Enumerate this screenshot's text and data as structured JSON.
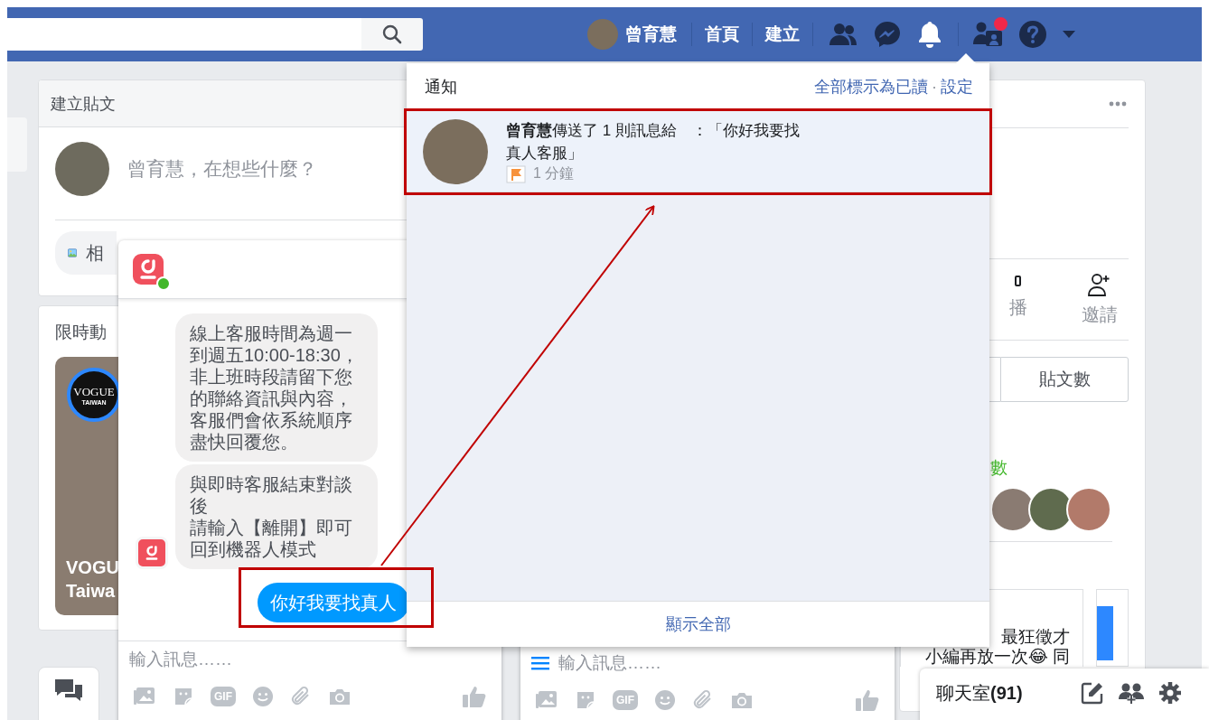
{
  "top_bar": {
    "profile_name": "曾育慧",
    "nav_links": [
      "首頁",
      "建立"
    ],
    "icons": [
      {
        "kind": "friends",
        "selected": false,
        "badge": false
      },
      {
        "kind": "messenger",
        "selected": false,
        "badge": false
      },
      {
        "kind": "notifications",
        "selected": true,
        "badge": false
      },
      {
        "kind": "friend_requests",
        "selected": false,
        "badge": true
      },
      {
        "kind": "help",
        "selected": false,
        "badge": false
      },
      {
        "kind": "account_menu",
        "selected": false,
        "badge": false
      }
    ]
  },
  "create_post": {
    "title": "建立貼文",
    "placeholder": "曾育慧，在想些什麼？",
    "photo_button": "相"
  },
  "stories": {
    "title": "限時動",
    "story": {
      "logo": [
        "VOGUE",
        "TAIWAN"
      ],
      "caption": [
        "VOGU",
        "Taiwa"
      ]
    }
  },
  "chat": {
    "online": true,
    "messages": [
      {
        "kind": "bot",
        "avatar": false,
        "paragraphs": [
          "線上客服時間為週一到週五10:00-18:30，非上班時段請留下您的聯絡資訊與內容，客服們會依系統順序盡快回覆您。"
        ]
      },
      {
        "kind": "bot",
        "avatar": true,
        "paragraphs": [
          "與即時客服結束對談後",
          "請輸入【離開】即可回到機器人模式"
        ]
      },
      {
        "kind": "user",
        "paragraphs": [
          "你好我要找真人"
        ]
      }
    ],
    "input_placeholder": "輸入訊息……",
    "tools": [
      {
        "kind": "photo"
      },
      {
        "kind": "sticker"
      },
      {
        "kind": "gif",
        "label": "GIF"
      },
      {
        "kind": "emoji"
      },
      {
        "kind": "attach"
      },
      {
        "kind": "camera"
      }
    ]
  },
  "chat_2": {
    "input_placeholder": "輸入訊息……",
    "tools": [
      {
        "kind": "photo"
      },
      {
        "kind": "sticker"
      },
      {
        "kind": "gif",
        "label": "GIF"
      },
      {
        "kind": "emoji"
      },
      {
        "kind": "attach"
      },
      {
        "kind": "camera"
      }
    ]
  },
  "page_panel": {
    "actions": [
      {
        "kind": "live",
        "label": "播"
      },
      {
        "kind": "invite",
        "label": "邀請"
      }
    ],
    "tab": "貼文數",
    "likes_label": "數",
    "post_preview": [
      "最狂徵才",
      "小編再放一次😂 同"
    ]
  },
  "notifications": {
    "title": "通知",
    "actions": [
      "全部標示為已讀",
      "設定"
    ],
    "separator": "·",
    "items": [
      {
        "text": "**曾育慧**傳送了 1 則訊息給　：「你好我要找真人客服」",
        "time": "1 分鐘",
        "unread": true
      }
    ],
    "footer": "顯示全部"
  },
  "chat_bar": {
    "label": "聊天室**(91)**"
  }
}
